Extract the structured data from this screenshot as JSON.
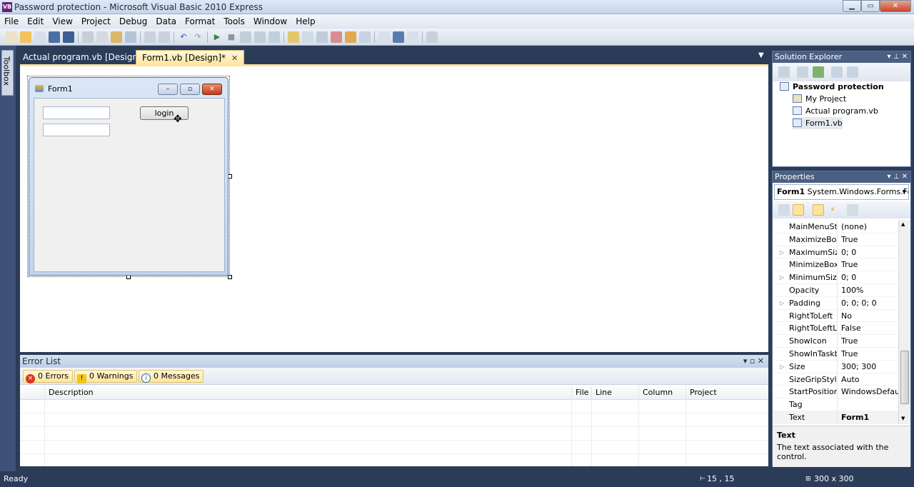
{
  "window": {
    "title": "Password protection - Microsoft Visual Basic 2010 Express",
    "icon_text": "VB",
    "minimize": "▁",
    "maximize": "▭",
    "close": "✕"
  },
  "menu": [
    "File",
    "Edit",
    "View",
    "Project",
    "Debug",
    "Data",
    "Format",
    "Tools",
    "Window",
    "Help"
  ],
  "toolbox_label": "Toolbox",
  "doc_tabs": {
    "tab1": "Actual program.vb [Design]",
    "tab2": "Form1.vb [Design]*",
    "close_glyph": "✕",
    "dropdown_glyph": "▼"
  },
  "form": {
    "title": "Form1",
    "min": "–",
    "max": "▫",
    "close": "✕",
    "button_label": "login",
    "cursor_glyph": "✥"
  },
  "error_list": {
    "title": "Error List",
    "controls": "▾ ▫ ✕",
    "filters": {
      "errors": "0 Errors",
      "warnings": "0 Warnings",
      "messages": "0 Messages"
    },
    "filter_icons": {
      "errors": "×",
      "warnings": "!",
      "messages": "i"
    },
    "columns": [
      "Description",
      "File",
      "Line",
      "Column",
      "Project"
    ]
  },
  "solution_explorer": {
    "title": "Solution Explorer",
    "controls": "▾ ⊥ ✕",
    "items": [
      "Password protection",
      "My Project",
      "Actual program.vb",
      "Form1.vb"
    ]
  },
  "properties": {
    "title": "Properties",
    "controls": "▾ ⊥ ✕",
    "object_name": "Form1",
    "object_type": "System.Windows.Forms.Fo",
    "object_dropdown": "▾",
    "rows": [
      {
        "name": "MainMenuStr",
        "value": "(none)",
        "expand": ""
      },
      {
        "name": "MaximizeBox",
        "value": "True",
        "expand": ""
      },
      {
        "name": "MaximumSize",
        "value": "0; 0",
        "expand": "▷"
      },
      {
        "name": "MinimizeBox",
        "value": "True",
        "expand": ""
      },
      {
        "name": "MinimumSize",
        "value": "0; 0",
        "expand": "▷"
      },
      {
        "name": "Opacity",
        "value": "100%",
        "expand": ""
      },
      {
        "name": "Padding",
        "value": "0; 0; 0; 0",
        "expand": "▷"
      },
      {
        "name": "RightToLeft",
        "value": "No",
        "expand": ""
      },
      {
        "name": "RightToLeftLa",
        "value": "False",
        "expand": ""
      },
      {
        "name": "ShowIcon",
        "value": "True",
        "expand": ""
      },
      {
        "name": "ShowInTaskb",
        "value": "True",
        "expand": ""
      },
      {
        "name": "Size",
        "value": "300; 300",
        "expand": "▷"
      },
      {
        "name": "SizeGripStyle",
        "value": "Auto",
        "expand": ""
      },
      {
        "name": "StartPosition",
        "value": "WindowsDefault",
        "expand": ""
      },
      {
        "name": "Tag",
        "value": "",
        "expand": ""
      },
      {
        "name": "Text",
        "value": "Form1",
        "expand": ""
      }
    ],
    "scroll_up": "▲",
    "scroll_down": "▼",
    "description_title": "Text",
    "description_text": "The text associated with the control."
  },
  "status": {
    "ready": "Ready",
    "position": "15 , 15",
    "size": "300 x 300"
  },
  "colors": {
    "accent": "#ffe6a0",
    "chrome": "#2b3c59",
    "panel_header": "#4b5f82"
  }
}
